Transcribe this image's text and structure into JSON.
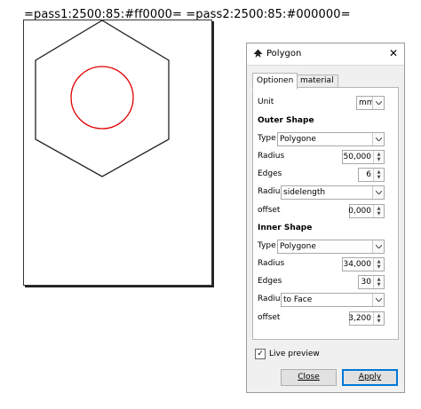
{
  "canvas": {
    "filename_label": "=pass1:2500:85:#ff0000= =pass2:2500:85:#000000=",
    "outer_color": "#222222",
    "inner_color": "#e00000"
  },
  "dialog": {
    "title": "Polygon",
    "tabs": [
      {
        "label": "Optionen",
        "active": true
      },
      {
        "label": "material",
        "active": false
      }
    ],
    "unit": {
      "label": "Unit",
      "value": "mm"
    },
    "outer": {
      "heading": "Outer Shape",
      "type_label": "Type",
      "type_value": "Polygone",
      "radius_label": "Radius",
      "radius_value": "50,000",
      "edges_label": "Edges",
      "edges_value": "6",
      "radius_mode_label": "Radius",
      "radius_mode_value": "sidelength",
      "offset_label": "offset",
      "offset_value": "0,000"
    },
    "inner": {
      "heading": "Inner Shape",
      "type_label": "Type",
      "type_value": "Polygone",
      "radius_label": "Radius",
      "radius_value": "34,000",
      "edges_label": "Edges",
      "edges_value": "30",
      "radius_mode_label": "Radius",
      "radius_mode_value": "to Face",
      "offset_label": "offset",
      "offset_value": "3,200"
    },
    "live_preview": {
      "label": "Live preview",
      "checked": true
    },
    "buttons": {
      "close": "Close",
      "apply": "Apply"
    }
  }
}
